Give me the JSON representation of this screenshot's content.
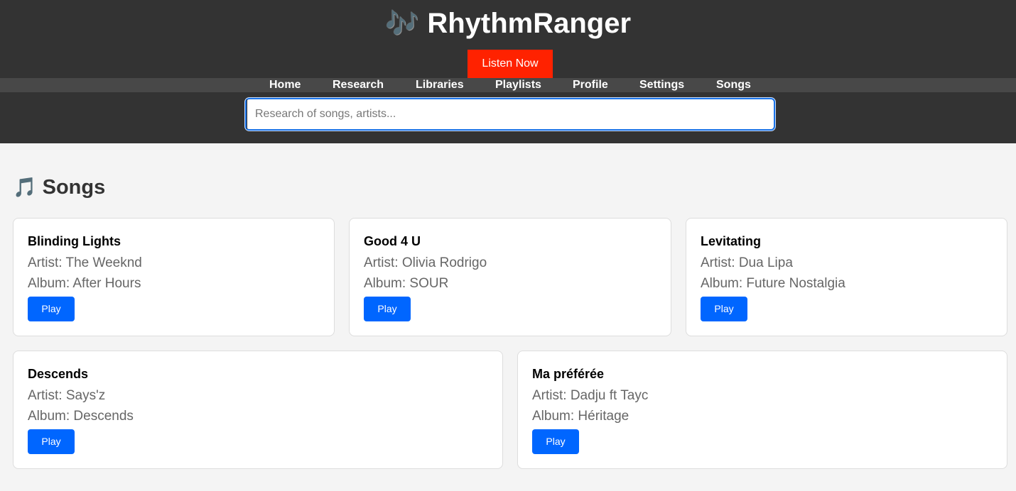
{
  "app": {
    "logo_icon": "🎶",
    "title": "RhythmRanger",
    "listen_now_label": "Listen Now"
  },
  "nav": {
    "items": [
      "Home",
      "Research",
      "Libraries",
      "Playlists",
      "Profile",
      "Settings",
      "Songs"
    ]
  },
  "search": {
    "placeholder": "Research of songs, artists...",
    "value": ""
  },
  "section": {
    "icon": "🎵",
    "title": "Songs"
  },
  "songs": [
    {
      "title": "Blinding Lights",
      "artist": "Artist: The Weeknd",
      "album": "Album: After Hours",
      "play_label": "Play"
    },
    {
      "title": "Good 4 U",
      "artist": "Artist: Olivia Rodrigo",
      "album": "Album: SOUR",
      "play_label": "Play"
    },
    {
      "title": "Levitating",
      "artist": "Artist: Dua Lipa",
      "album": "Album: Future Nostalgia",
      "play_label": "Play"
    },
    {
      "title": "Descends",
      "artist": "Artist: Says'z",
      "album": "Album: Descends",
      "play_label": "Play"
    },
    {
      "title": "Ma préférée",
      "artist": "Artist: Dadju ft Tayc",
      "album": "Album: Héritage",
      "play_label": "Play"
    }
  ],
  "colors": {
    "header_bg": "#333333",
    "nav_bg": "#484848",
    "listen_btn": "#ff2200",
    "play_btn": "#0066ff",
    "search_focus": "#1a73e8"
  }
}
